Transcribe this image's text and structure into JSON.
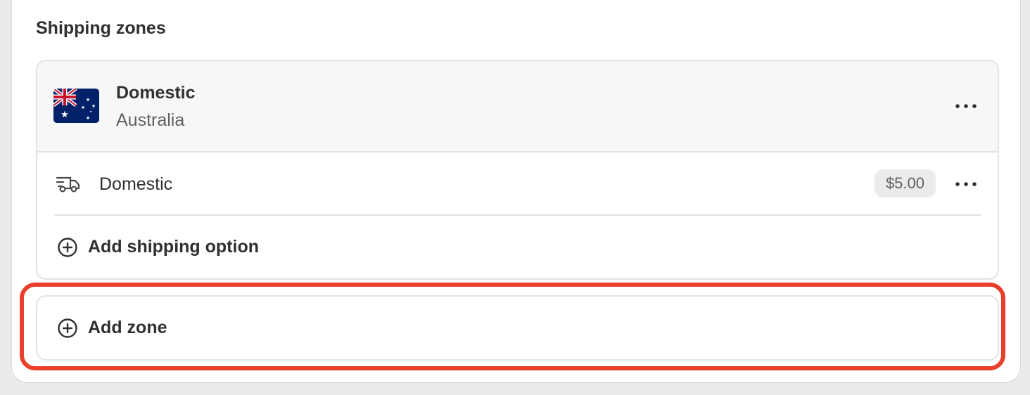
{
  "section": {
    "title": "Shipping zones"
  },
  "zone": {
    "name": "Domestic",
    "country": "Australia",
    "flag_icon": "australia-flag-icon"
  },
  "rate": {
    "name": "Domestic",
    "price": "$5.00",
    "icon": "delivery-truck-icon"
  },
  "actions": {
    "add_shipping_option": "Add shipping option",
    "add_zone": "Add zone"
  },
  "colors": {
    "highlight": "#e8402a",
    "header_bg": "#f7f7f7",
    "badge_bg": "#ebebeb"
  }
}
